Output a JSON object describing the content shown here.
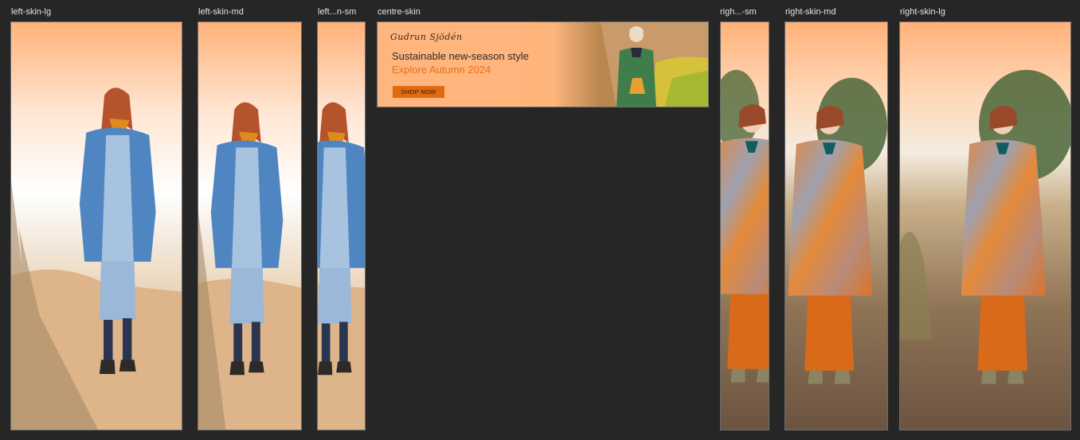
{
  "skins": {
    "left_lg": "left-skin-lg",
    "left_md": "left-skin-md",
    "left_sm": "left...n-sm",
    "centre": "centre-skin",
    "right_sm": "righ...-sm",
    "right_md": "right-skin-md",
    "right_lg": "right-skin-lg"
  },
  "banner": {
    "logo": "Gudrun Sjödén",
    "headline": "Sustainable new-season style",
    "subheadline": "Explore Autumn 2024",
    "cta": "SHOP NOW"
  },
  "colors": {
    "background": "#262626",
    "banner_orange": "#ffb57e",
    "accent": "#e06a10",
    "sub_text": "#e8701c"
  }
}
